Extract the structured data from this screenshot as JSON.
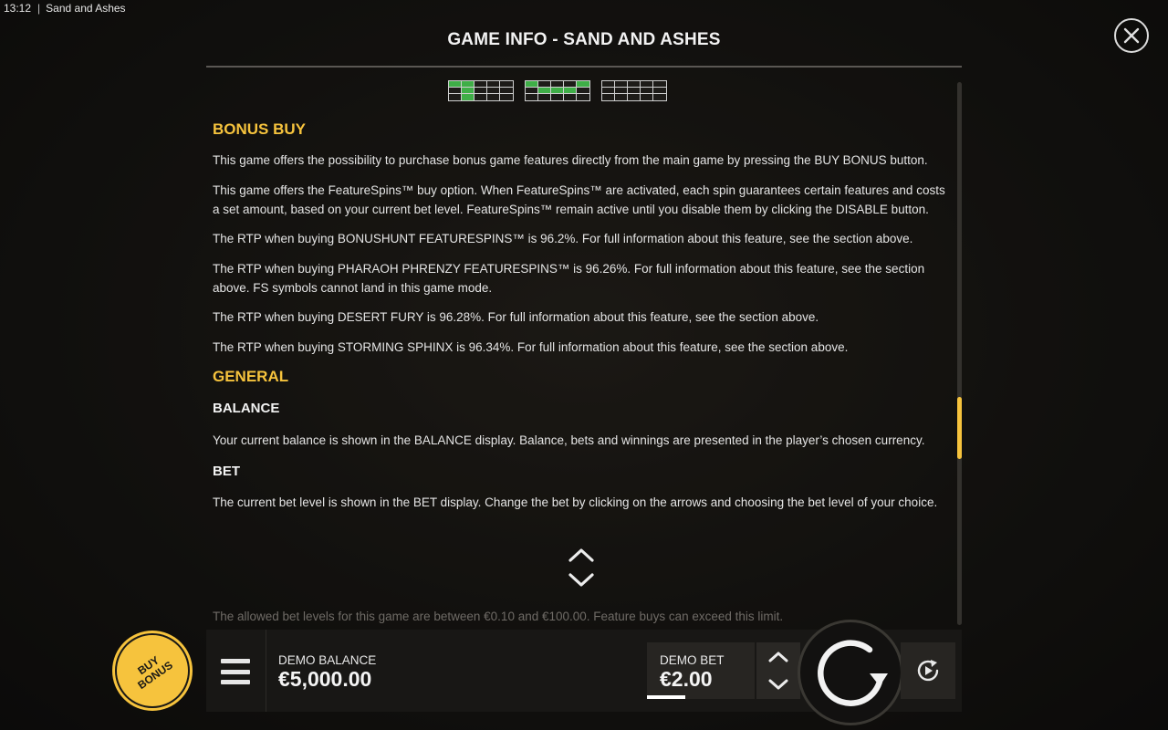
{
  "system": {
    "time": "13:12",
    "app_title": "Sand and Ashes"
  },
  "dialog": {
    "title": "GAME INFO - SAND AND ASHES",
    "close_icon": "close-icon"
  },
  "paylines": [
    {
      "active": [
        0,
        1,
        6,
        11
      ]
    },
    {
      "active": [
        0,
        6,
        7,
        8,
        4
      ]
    },
    {
      "active": []
    }
  ],
  "bonus_buy": {
    "heading": "BONUS BUY",
    "paragraphs": [
      "This game offers the possibility to purchase bonus game features directly from the main game by pressing the BUY BONUS button.",
      "This game offers the FeatureSpins™ buy option. When FeatureSpins™ are activated, each spin guarantees certain features and costs a set amount, based on your current bet level. FeatureSpins™ remain active until you disable them by clicking the DISABLE button.",
      "The RTP when buying BONUSHUNT FEATURESPINS™ is 96.2%. For full information about this feature, see the section above.",
      "The RTP when buying PHARAOH PHRENZY FEATURESPINS™ is 96.26%. For full information about this feature, see the section above. FS symbols cannot land in this game mode.",
      "The RTP when buying DESERT FURY is 96.28%. For full information about this feature, see the section above.",
      "The RTP when buying STORMING SPHINX is 96.34%. For full information about this feature, see the section above."
    ]
  },
  "general": {
    "heading": "GENERAL",
    "balance_heading": "BALANCE",
    "balance_text": "Your current balance is shown in the BALANCE display. Balance, bets and winnings are presented in the player’s chosen currency.",
    "bet_heading": "BET",
    "bet_text": "The current bet level is shown in the BET display. Change the bet by clicking on the arrows and choosing the bet level of your choice.",
    "bet_limits_text": "The allowed bet levels for this game are between €0.10 and €100.00. Feature buys can exceed this limit."
  },
  "bottom_bar": {
    "buy_bonus_line1": "BUY",
    "buy_bonus_line2": "BONUS",
    "balance_label": "DEMO BALANCE",
    "balance_value": "€5,000.00",
    "bet_label": "DEMO BET",
    "bet_value": "€2.00"
  },
  "colors": {
    "accent": "#f6c33d",
    "payline_active": "#3fae47"
  },
  "scroll": {
    "position_fraction": 0.58
  }
}
